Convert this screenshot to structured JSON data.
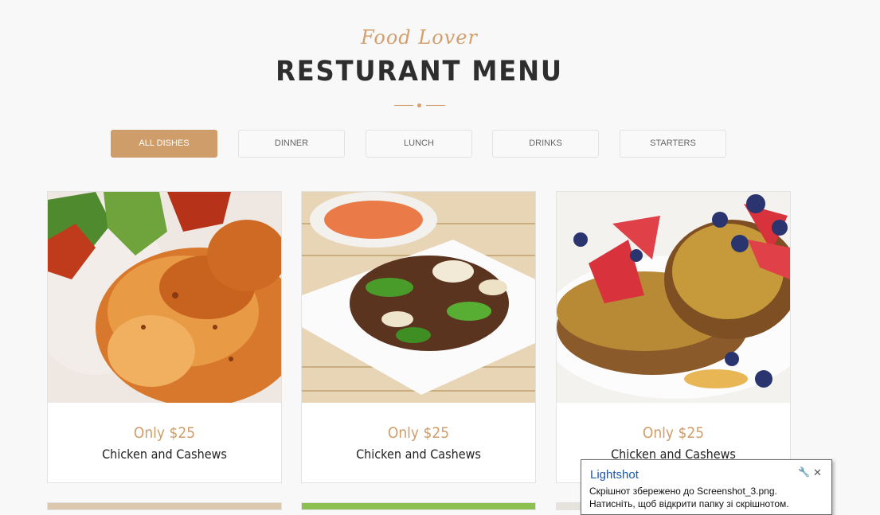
{
  "header": {
    "subtitle": "Food Lover",
    "title": "RESTURANT MENU"
  },
  "filters": [
    {
      "label": "ALL DISHES",
      "active": true
    },
    {
      "label": "DINNER",
      "active": false
    },
    {
      "label": "LUNCH",
      "active": false
    },
    {
      "label": "DRINKS",
      "active": false
    },
    {
      "label": "STARTERS",
      "active": false
    }
  ],
  "menu_items": [
    {
      "price": "Only $25",
      "name": "Chicken and Cashews",
      "image": "roast-chicken-leg-photo"
    },
    {
      "price": "Only $25",
      "name": "Chicken and Cashews",
      "image": "beef-pepper-stir-fry-photo"
    },
    {
      "price": "Only $25",
      "name": "Chicken and Cashews",
      "image": "french-toast-berries-photo"
    }
  ],
  "notification": {
    "title": "Lightshot",
    "message": "Скрішнот збережено до Screenshot_3.png. Натисніть, щоб відкрити папку зі скрішнотом.",
    "settings_icon": "wrench-icon",
    "close_icon": "close-icon"
  },
  "colors": {
    "accent": "#cf9d6a",
    "background": "#f8f8f8",
    "title": "#2e2e2e"
  }
}
